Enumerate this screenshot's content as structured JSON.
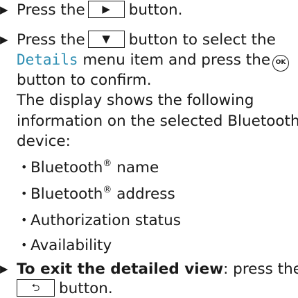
{
  "arrow_glyph": "▶",
  "step1": {
    "pre": "Press the",
    "key_glyph": "▶",
    "post": "button."
  },
  "step2": {
    "pre": "Press the",
    "key_glyph": "▼",
    "post": "button to select the",
    "menu_item": "Details",
    "mid": "menu item and press the",
    "ok_label": "OK",
    "tail": "button to confirm.",
    "desc_line1": "The display shows the following",
    "desc_line2_pre": "information on the selected Bluetooth",
    "reg": "®",
    "desc_line3": "device:"
  },
  "bullets": [
    {
      "pre": "Bluetooth",
      "sup": "®",
      "post": " name"
    },
    {
      "pre": "Bluetooth",
      "sup": "®",
      "post": " address"
    },
    {
      "pre": "Authorization status",
      "sup": "",
      "post": ""
    },
    {
      "pre": "Availability",
      "sup": "",
      "post": ""
    }
  ],
  "bullet_glyph": "•",
  "step3": {
    "bold": "To exit the detailed view",
    "rest": ": press the",
    "key_glyph": "⮌",
    "post": "button."
  }
}
